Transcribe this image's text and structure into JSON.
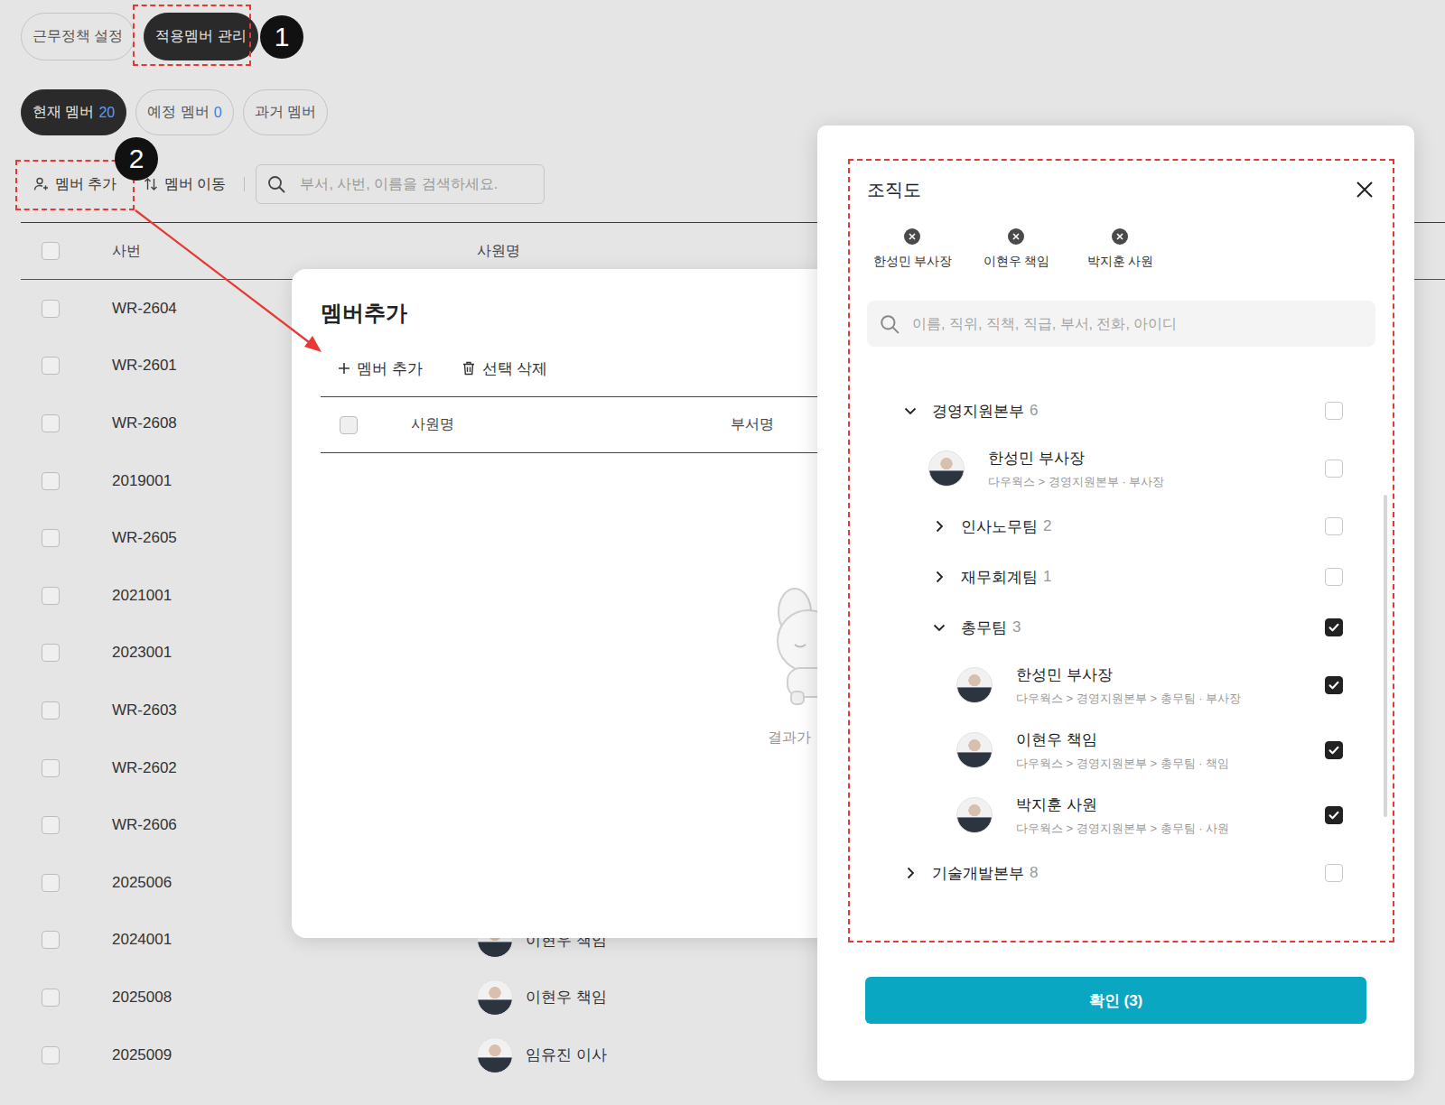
{
  "policy_tabs": [
    {
      "label": "근무정책 설정",
      "selected": false
    },
    {
      "label": "적용멤버 관리",
      "selected": true
    }
  ],
  "member_tabs": [
    {
      "label": "현재 멤버",
      "count": "20",
      "selected": true
    },
    {
      "label": "예정 멤버",
      "count": "0",
      "selected": false
    },
    {
      "label": "과거 멤버",
      "selected": false
    }
  ],
  "toolbar": {
    "add": "멤버 추가",
    "move": "멤버 이동",
    "search_placeholder": "부서, 사번, 이름을 검색하세요."
  },
  "table": {
    "header_checked": false,
    "columns": [
      "사번",
      "사원명"
    ],
    "rows": [
      {
        "id": "WR-2604",
        "checked": false
      },
      {
        "id": "WR-2601",
        "checked": false
      },
      {
        "id": "WR-2608",
        "checked": false
      },
      {
        "id": "2019001",
        "checked": false
      },
      {
        "id": "WR-2605",
        "checked": false
      },
      {
        "id": "2021001",
        "checked": false
      },
      {
        "id": "2023001",
        "checked": false
      },
      {
        "id": "WR-2603",
        "checked": false
      },
      {
        "id": "WR-2602",
        "checked": false
      },
      {
        "id": "WR-2606",
        "checked": false
      },
      {
        "id": "2025006",
        "checked": false
      },
      {
        "id": "2024001",
        "checked": false,
        "name": "이현우 책임"
      },
      {
        "id": "2025008",
        "checked": false,
        "name": "이현우 책임"
      },
      {
        "id": "2025009",
        "checked": false,
        "name": "임유진 이사"
      }
    ]
  },
  "annotations": [
    {
      "number": "1"
    },
    {
      "number": "2"
    }
  ],
  "add_dialog": {
    "title": "멤버추가",
    "add": "멤버 추가",
    "delete": "선택 삭제",
    "header_checked": false,
    "columns": [
      "사원명",
      "부서명"
    ],
    "empty": "결과가"
  },
  "org_picker": {
    "title": "조직도",
    "chips": [
      {
        "name": "한성민 부사장"
      },
      {
        "name": "이현우 책임"
      },
      {
        "name": "박지훈 사원"
      }
    ],
    "search_placeholder": "이름, 직위, 직책, 직급, 부서, 전화, 아이디",
    "tree": [
      {
        "kind": "group",
        "depth": 0,
        "label": "경영지원본부",
        "count": "6",
        "expanded": true,
        "checked": false
      },
      {
        "kind": "person",
        "depth": 1,
        "name": "한성민 부사장",
        "path": "다우웍스 > 경영지원본부 · 부사장",
        "checked": false
      },
      {
        "kind": "group",
        "depth": 1,
        "label": "인사노무팀",
        "count": "2",
        "expanded": false,
        "checked": false
      },
      {
        "kind": "group",
        "depth": 1,
        "label": "재무회계팀",
        "count": "1",
        "expanded": false,
        "checked": false
      },
      {
        "kind": "group",
        "depth": 1,
        "label": "총무팀",
        "count": "3",
        "expanded": true,
        "checked": true
      },
      {
        "kind": "person",
        "depth": 2,
        "name": "한성민 부사장",
        "path": "다우웍스 > 경영지원본부 > 총무팀 · 부사장",
        "checked": true
      },
      {
        "kind": "person",
        "depth": 2,
        "name": "이현우 책임",
        "path": "다우웍스 > 경영지원본부 > 총무팀 · 책임",
        "checked": true
      },
      {
        "kind": "person",
        "depth": 2,
        "name": "박지훈 사원",
        "path": "다우웍스 > 경영지원본부 > 총무팀 · 사원",
        "checked": true
      },
      {
        "kind": "group",
        "depth": 0,
        "label": "기술개발본부",
        "count": "8",
        "expanded": false,
        "checked": false
      }
    ],
    "confirm": "확인 (3)"
  }
}
